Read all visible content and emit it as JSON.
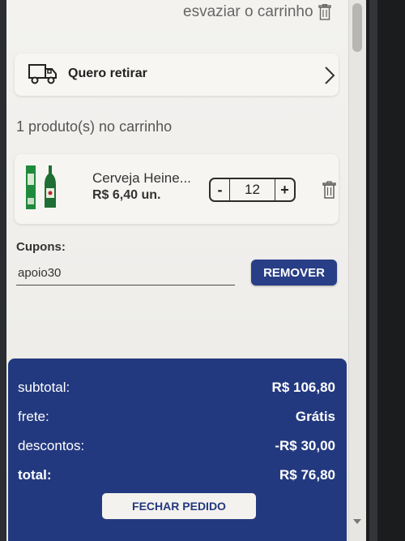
{
  "header": {
    "clear_cart_label": "esvaziar o carrinho"
  },
  "pickup": {
    "label": "Quero retirar"
  },
  "cart": {
    "count_label": "1 produto(s) no carrinho",
    "items": [
      {
        "name": "Cerveja Heine...",
        "price": "R$ 6,40 un.",
        "quantity": "12",
        "minus": "-",
        "plus": "+"
      }
    ]
  },
  "coupon": {
    "label": "Cupons:",
    "value": "apoio30",
    "remove_label": "REMOVER"
  },
  "summary": {
    "subtotal_label": "subtotal:",
    "subtotal_value": "R$ 106,80",
    "shipping_label": "frete:",
    "shipping_value": "Grátis",
    "discount_label": "descontos:",
    "discount_value": "-R$ 30,00",
    "total_label": "total:",
    "total_value": "R$ 76,80",
    "checkout_label": "FECHAR PEDIDO"
  },
  "colors": {
    "primary": "#23397f",
    "button": "#283e86",
    "background": "#f2f1ee"
  },
  "icons": [
    "trash-icon",
    "truck-icon",
    "chevron-right-icon",
    "beer-bottle-icon"
  ]
}
